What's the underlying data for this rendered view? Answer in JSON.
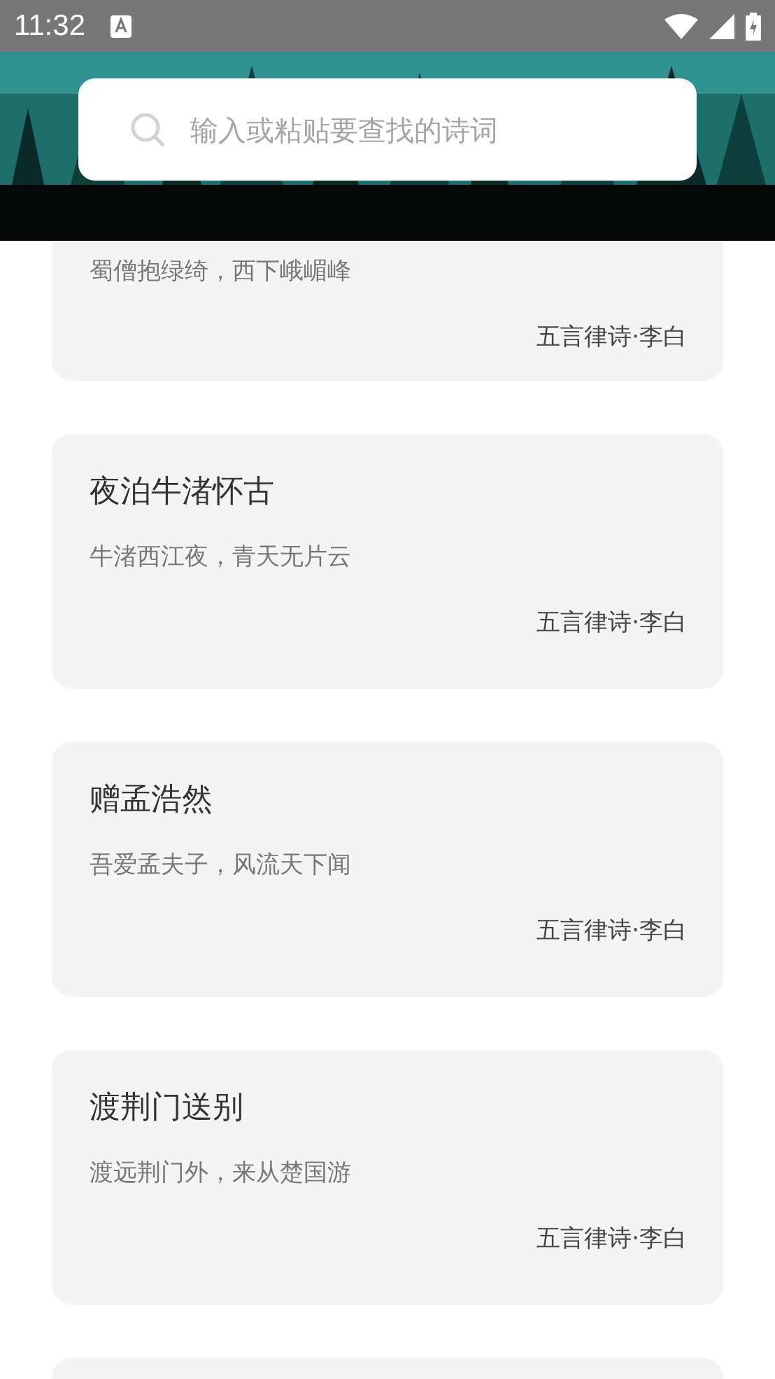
{
  "status_bar": {
    "time": "11:32"
  },
  "search": {
    "placeholder": "输入或粘贴要查找的诗词"
  },
  "poems": [
    {
      "kind": "partial",
      "line": "蜀僧抱绿绮，西下峨嵋峰",
      "meta": "五言律诗·李白"
    },
    {
      "kind": "full",
      "title": "夜泊牛渚怀古",
      "line": "牛渚西江夜，青天无片云",
      "meta": "五言律诗·李白"
    },
    {
      "kind": "full",
      "title": "赠孟浩然",
      "line": "吾爱孟夫子，风流天下闻",
      "meta": "五言律诗·李白"
    },
    {
      "kind": "full",
      "title": "渡荆门送别",
      "line": "渡远荆门外，来从楚国游",
      "meta": "五言律诗·李白"
    },
    {
      "kind": "partial"
    }
  ]
}
